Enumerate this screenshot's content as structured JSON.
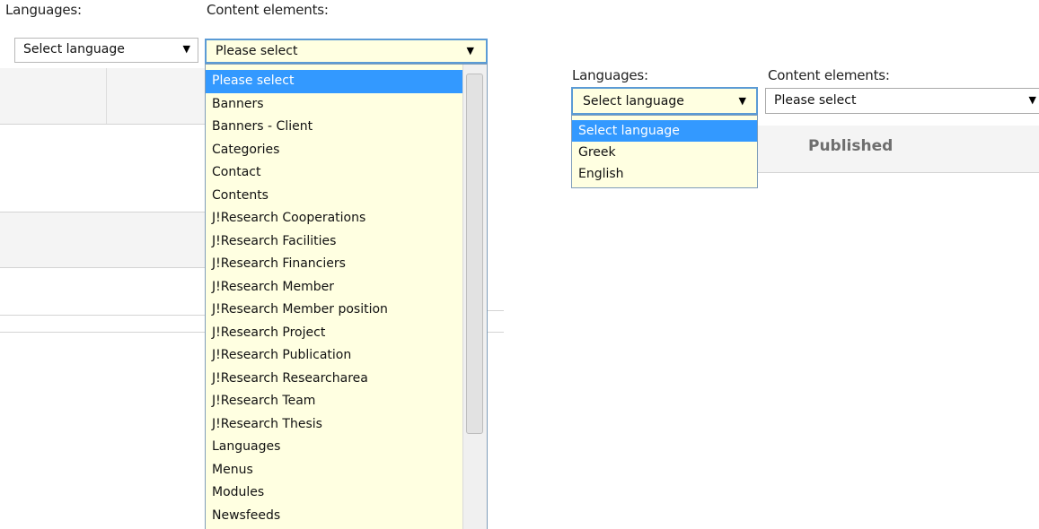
{
  "left_panel": {
    "languages_label": "Languages:",
    "content_elements_label": "Content elements:",
    "language_select": {
      "value": "Select language",
      "arrow": "▼"
    },
    "content_select": {
      "value": "Please select",
      "arrow": "▼",
      "options": [
        {
          "label": "Please select",
          "selected": true
        },
        {
          "label": "Banners"
        },
        {
          "label": "Banners - Client"
        },
        {
          "label": "Categories"
        },
        {
          "label": "Contact"
        },
        {
          "label": "Contents"
        },
        {
          "label": "J!Research Cooperations"
        },
        {
          "label": "J!Research Facilities"
        },
        {
          "label": "J!Research Financiers"
        },
        {
          "label": "J!Research Member"
        },
        {
          "label": "J!Research Member position"
        },
        {
          "label": "J!Research Project"
        },
        {
          "label": "J!Research Publication"
        },
        {
          "label": "J!Research Researcharea"
        },
        {
          "label": "J!Research Team"
        },
        {
          "label": "J!Research Thesis"
        },
        {
          "label": "Languages"
        },
        {
          "label": "Menus"
        },
        {
          "label": "Modules"
        },
        {
          "label": "Newsfeeds"
        }
      ]
    }
  },
  "right_panel": {
    "languages_label": "Languages:",
    "content_elements_label": "Content elements:",
    "language_select": {
      "value": "Select language",
      "arrow": "▼",
      "options": [
        {
          "label": "Select language",
          "selected": true
        },
        {
          "label": "Greek"
        },
        {
          "label": "English"
        }
      ]
    },
    "content_select": {
      "value": "Please select",
      "arrow": "▼"
    },
    "table_header": {
      "published": "Published"
    }
  },
  "colors": {
    "dropdown_bg": "#ffffe1",
    "highlight": "#3399ff",
    "header_text": "#6e6e6e"
  }
}
